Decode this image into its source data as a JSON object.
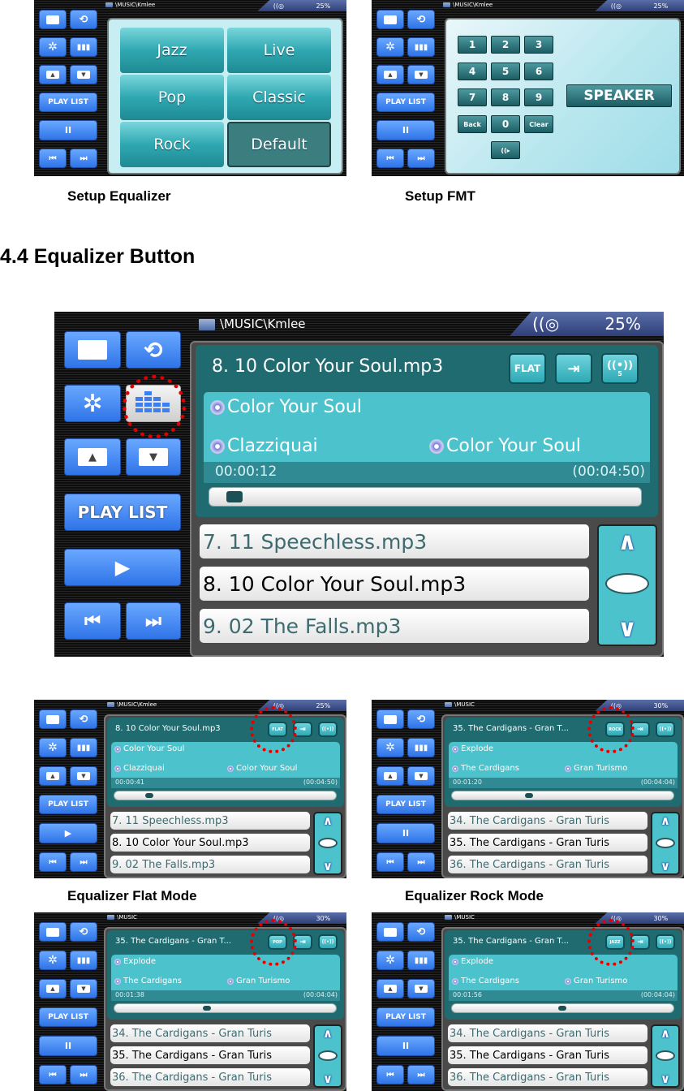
{
  "captions": {
    "setup_equalizer": "Setup Equalizer",
    "setup_fmt": "Setup FMT",
    "eq_flat": "Equalizer Flat Mode",
    "eq_rock": "Equalizer Rock Mode"
  },
  "section_heading": "4.4 Equalizer Button",
  "sidebar": {
    "folder_icon": "folder-icon",
    "repeat_icon": "repeat-icon",
    "settings_icon": "gear-icon",
    "equalizer_icon": "equalizer-icon",
    "up_icon": "triangle-up-icon",
    "down_icon": "triangle-down-icon",
    "playlist_label": "PLAY LIST",
    "pause_glyph": "II",
    "play_glyph": "▶",
    "prev_glyph": "⏮",
    "next_glyph": "⏭"
  },
  "glyphs": {
    "up_arrow": "∧",
    "down_arrow": "∨",
    "signal": "((◎",
    "speaker_fm": "((▸"
  },
  "screens": {
    "setup_eq": {
      "path": "\\MUSIC\\Kmlee",
      "battery": "25%",
      "presets": [
        "Jazz",
        "Live",
        "Pop",
        "Classic",
        "Rock",
        "Default"
      ],
      "selected_preset": "Default"
    },
    "setup_fmt": {
      "path": "\\MUSIC\\Kmlee",
      "battery": "25%",
      "keys": [
        "1",
        "2",
        "3",
        "4",
        "5",
        "6",
        "7",
        "8",
        "9",
        "Back",
        "0",
        "Clear"
      ],
      "speaker_label": "SPEAKER"
    },
    "main": {
      "path": "\\MUSIC\\Kmlee",
      "battery": "25%",
      "now_playing": "8. 10 Color Your Soul.mp3",
      "eq_mode": "FLAT",
      "title": "Color Your Soul",
      "artist": "Clazziquai",
      "album": "Color Your Soul",
      "elapsed": "00:00:12",
      "total": "(00:04:50)",
      "progress": 0.04,
      "playlist": [
        "7. 11 Speechless.mp3",
        "8. 10 Color Your Soul.mp3",
        "9. 02 The Falls.mp3"
      ],
      "current_index": 1,
      "surround_label": "5"
    },
    "flat": {
      "path": "\\MUSIC\\Kmlee",
      "battery": "25%",
      "now_playing": "8. 10 Color Your Soul.mp3",
      "eq_mode": "FLAT",
      "title": "Color Your Soul",
      "artist": "Clazziquai",
      "album": "Color Your Soul",
      "elapsed": "00:00:41",
      "total": "(00:04:50)",
      "progress": 0.14,
      "playlist": [
        "7. 11 Speechless.mp3",
        "8. 10 Color Your Soul.mp3",
        "9. 02 The Falls.mp3"
      ],
      "current_index": 1,
      "playing": false
    },
    "rock": {
      "path": "\\MUSIC",
      "battery": "30%",
      "now_playing": "35. The Cardigans - Gran T...",
      "eq_mode": "ROCK",
      "title": "Explode",
      "artist": "The Cardigans",
      "album": "Gran Turismo",
      "elapsed": "00:01:20",
      "total": "(00:04:04)",
      "progress": 0.33,
      "playlist": [
        "34. The Cardigans - Gran Turis",
        "35. The Cardigans - Gran Turis",
        "36. The Cardigans - Gran Turis"
      ],
      "current_index": 1,
      "playing": true
    },
    "pop": {
      "path": "\\MUSIC",
      "battery": "30%",
      "now_playing": "35. The Cardigans - Gran T...",
      "eq_mode": "POP",
      "title": "Explode",
      "artist": "The Cardigans",
      "album": "Gran Turismo",
      "elapsed": "00:01:38",
      "total": "(00:04:04)",
      "progress": 0.4,
      "playlist": [
        "34. The Cardigans - Gran Turis",
        "35. The Cardigans - Gran Turis",
        "36. The Cardigans - Gran Turis"
      ],
      "current_index": 1,
      "playing": true
    },
    "jazz": {
      "path": "\\MUSIC",
      "battery": "30%",
      "now_playing": "35. The Cardigans - Gran T...",
      "eq_mode": "JAZZ",
      "title": "Explode",
      "artist": "The Cardigans",
      "album": "Gran Turismo",
      "elapsed": "00:01:56",
      "total": "(00:04:04)",
      "progress": 0.48,
      "playlist": [
        "34. The Cardigans - Gran Turis",
        "35. The Cardigans - Gran Turis",
        "36. The Cardigans - Gran Turis"
      ],
      "current_index": 1,
      "playing": true
    }
  },
  "colors": {
    "highlight_circle": "#e00000",
    "sidebar_button": "#3d86f2",
    "teal_panel": "#4bc2cc"
  }
}
